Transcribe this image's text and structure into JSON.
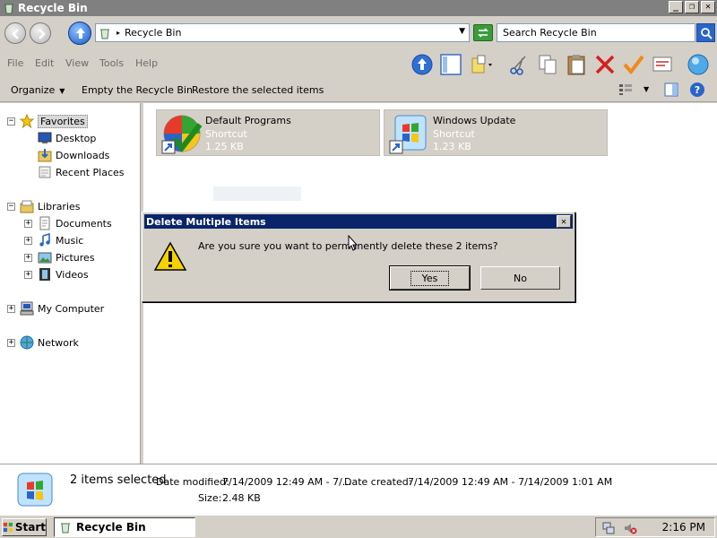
{
  "window": {
    "title": "Recycle Bin",
    "minimize": "_",
    "maximize": "❐",
    "close": "✕"
  },
  "address": {
    "location": "Recycle Bin",
    "search_placeholder": "Search Recycle Bin"
  },
  "menu": [
    "File",
    "Edit",
    "View",
    "Tools",
    "Help"
  ],
  "commands": {
    "organize": "Organize",
    "empty": "Empty the Recycle Bin",
    "restore": "Restore the selected items"
  },
  "nav": {
    "favorites": "Favorites",
    "desktop": "Desktop",
    "downloads": "Downloads",
    "recent": "Recent Places",
    "libraries": "Libraries",
    "documents": "Documents",
    "music": "Music",
    "pictures": "Pictures",
    "videos": "Videos",
    "computer": "My Computer",
    "network": "Network"
  },
  "files": [
    {
      "name": "Default Programs",
      "type": "Shortcut",
      "size": "1.25 KB"
    },
    {
      "name": "Windows Update",
      "type": "Shortcut",
      "size": "1.23 KB"
    }
  ],
  "dialog": {
    "title": "Delete Multiple Items",
    "message": "Are you sure you want to permanently delete these 2 items?",
    "yes": "Yes",
    "no": "No"
  },
  "details": {
    "count": "2 items selected",
    "modified_label": "Date modified:",
    "modified_value": "7/14/2009 12:49 AM - 7/...",
    "created_label": "Date created:",
    "created_value": "7/14/2009 12:49 AM - 7/14/2009 1:01 AM",
    "size_label": "Size:",
    "size_value": "2.48 KB"
  },
  "taskbar": {
    "start": "Start",
    "task": "Recycle Bin",
    "clock": "2:16 PM"
  },
  "colors": {
    "dialog_title": "#0a246a",
    "window_title": "#808080",
    "face": "#d4d0c8"
  }
}
